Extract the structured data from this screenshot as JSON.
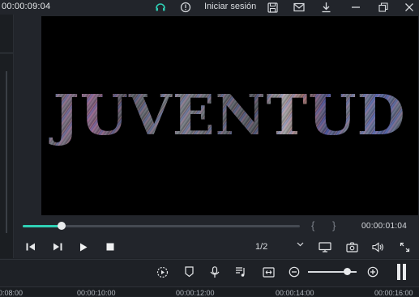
{
  "header": {
    "timecode": "00:00:09:04",
    "signin_label": "Iniciar sesión",
    "icons": [
      "headset-icon",
      "info-icon",
      "save-icon",
      "mail-icon",
      "download-icon",
      "minimize-icon",
      "restore-icon",
      "close-icon"
    ]
  },
  "preview": {
    "title_text": "JUVENTUD",
    "progress": 0.14,
    "brace_open": "{",
    "brace_close": "}",
    "duration": "00:00:01:04"
  },
  "controls": {
    "resolution": "1/2",
    "icons": [
      "step-back-icon",
      "step-forward-icon",
      "play-icon",
      "stop-icon",
      "display-icon",
      "snapshot-icon",
      "volume-icon",
      "fullscreen-icon"
    ]
  },
  "toolbar": {
    "icons": [
      "render-icon",
      "marker-icon",
      "microphone-icon",
      "audio-mixer-icon",
      "split-icon",
      "zoom-out-icon",
      "zoom-in-icon",
      "pause-icon"
    ],
    "zoom_level": 0.8
  },
  "ruler": {
    "labels": [
      "0:08:00",
      "00:00:10:00",
      "00:00:12:00",
      "00:00:14:00",
      "00:00:16:00"
    ]
  },
  "colors": {
    "accent": "#2fd0b5",
    "background": "#22252b",
    "viewer": "#000000"
  }
}
